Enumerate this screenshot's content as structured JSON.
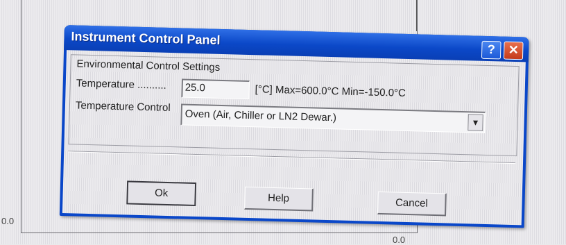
{
  "background": {
    "axis_left_label": "0.0",
    "axis_bottom_label": "0.0"
  },
  "dialog": {
    "title": "Instrument Control Panel",
    "help_button_label": "?",
    "close_button_label": "✕",
    "group_title": "Environmental Control Settings",
    "temperature": {
      "label": "Temperature ..........",
      "value": "25.0",
      "limits_text": "[°C] Max=600.0°C  Min=-150.0°C"
    },
    "temperature_control": {
      "label": "Temperature Control",
      "selected": "Oven (Air, Chiller or LN2 Dewar.)",
      "dropdown_glyph": "▼"
    },
    "buttons": {
      "ok": "Ok",
      "help": "Help",
      "cancel": "Cancel"
    }
  },
  "colors": {
    "titlebar": "#0b48c8",
    "close_button": "#c43a1a",
    "window_face": "#e4e3e8"
  }
}
